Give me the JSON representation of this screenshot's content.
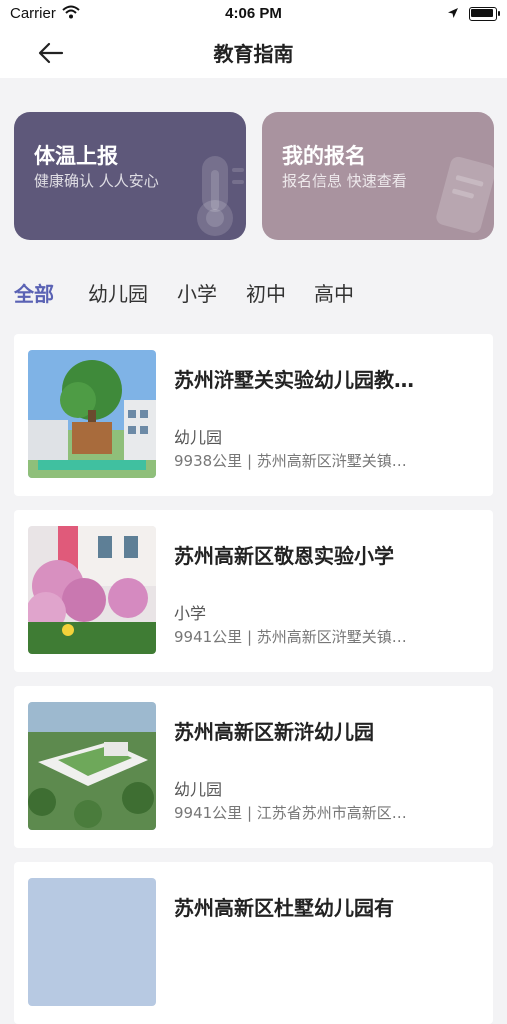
{
  "status": {
    "carrier": "Carrier",
    "time": "4:06 PM"
  },
  "nav": {
    "title": "教育指南"
  },
  "cards": [
    {
      "title": "体温上报",
      "subtitle": "健康确认 人人安心",
      "color": "#5e587a",
      "icon": "thermometer-icon"
    },
    {
      "title": "我的报名",
      "subtitle": "报名信息 快速查看",
      "color": "#a9939f",
      "icon": "form-icon"
    }
  ],
  "tabs": [
    "全部",
    "幼儿园",
    "小学",
    "初中",
    "高中"
  ],
  "accent": "#5a62b4",
  "schools": [
    {
      "name": "苏州浒墅关实验幼儿园教…",
      "category": "幼儿园",
      "distance": "9938公里",
      "address": "苏州高新区浒墅关镇…"
    },
    {
      "name": "苏州高新区敬恩实验小学",
      "category": "小学",
      "distance": "9941公里",
      "address": "苏州高新区浒墅关镇…"
    },
    {
      "name": "苏州高新区新浒幼儿园",
      "category": "幼儿园",
      "distance": "9941公里",
      "address": "江苏省苏州市高新区…"
    },
    {
      "name": "苏州高新区杜墅幼儿园有",
      "category": "",
      "distance": "",
      "address": ""
    }
  ]
}
